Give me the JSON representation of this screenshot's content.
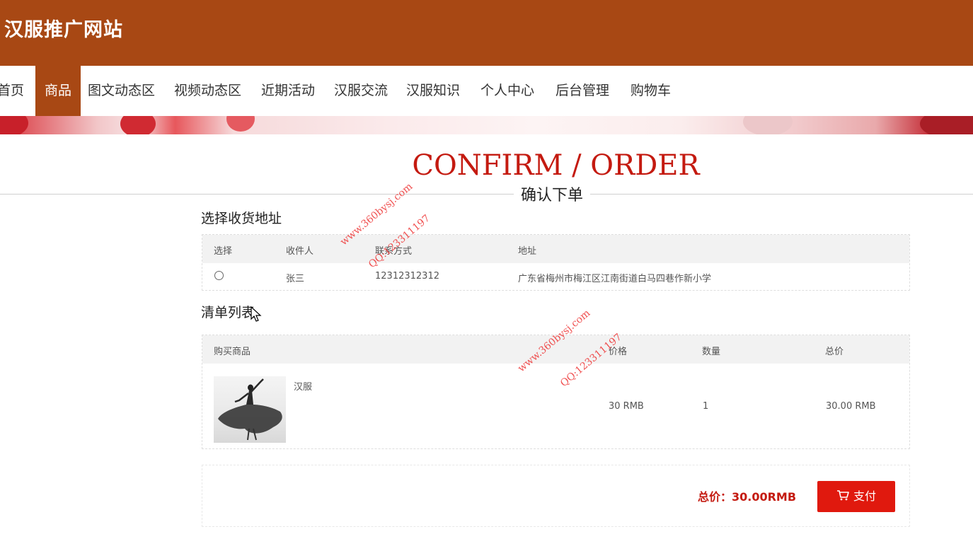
{
  "header": {
    "site_title": "汉服推广网站"
  },
  "nav": [
    {
      "label": "首页",
      "active": false
    },
    {
      "label": "商品",
      "active": true
    },
    {
      "label": "图文动态区",
      "active": false
    },
    {
      "label": "视频动态区",
      "active": false
    },
    {
      "label": "近期活动",
      "active": false
    },
    {
      "label": "汉服交流",
      "active": false
    },
    {
      "label": "汉服知识",
      "active": false
    },
    {
      "label": "个人中心",
      "active": false
    },
    {
      "label": "后台管理",
      "active": false
    },
    {
      "label": "购物车",
      "active": false
    }
  ],
  "page": {
    "title_en": "CONFIRM / ORDER",
    "title_cn": "确认下单"
  },
  "address_section": {
    "title": "选择收货地址",
    "headers": {
      "select": "选择",
      "receiver": "收件人",
      "contact": "联系方式",
      "address": "地址"
    },
    "rows": [
      {
        "receiver": "张三",
        "contact": "12312312312",
        "address": "广东省梅州市梅江区江南街道白马四巷作新小学"
      }
    ]
  },
  "items_section": {
    "title": "清单列表",
    "headers": {
      "product": "购买商品",
      "price": "价格",
      "qty": "数量",
      "total": "总价"
    },
    "rows": [
      {
        "name": "汉服",
        "price": "30 RMB",
        "qty": "1",
        "total": "30.00 RMB"
      }
    ]
  },
  "summary": {
    "total_text": "总价：30.00RMB",
    "pay_label": "支付"
  },
  "watermarks": [
    {
      "site": "www.360bysj.com",
      "qq": "QQ:123311197"
    },
    {
      "site": "www.360bysj.com",
      "qq": "QQ:123311197"
    }
  ],
  "colors": {
    "brand": "#a84814",
    "accent": "#c41a10",
    "pay": "#e0190e"
  },
  "icons": {
    "cart": "cart-icon",
    "radio": "radio-unchecked-icon",
    "cursor": "mouse-cursor-icon"
  }
}
